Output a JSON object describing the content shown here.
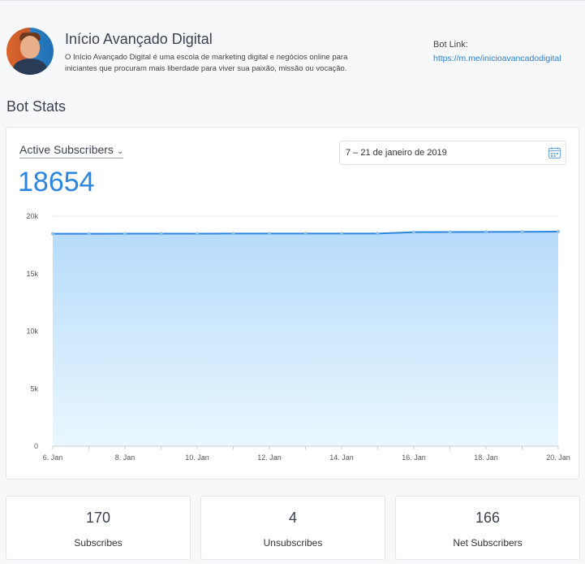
{
  "profile": {
    "name": "Início Avançado Digital",
    "description": "O Início Avançado Digital é uma escola de marketing digital e negócios online para iniciantes que procuram mais liberdade para viver sua paixão, missão ou vocação.",
    "bot_link_label": "Bot Link:",
    "bot_link_url": "https://m.me/inicioavancadodigital"
  },
  "section_title": "Bot Stats",
  "stats_card": {
    "metric_label": "Active Subscribers",
    "date_range": "7 – 21 de janeiro de 2019",
    "current_value": "18654"
  },
  "colors": {
    "accent": "#2a86e0",
    "line": "#2a86e0",
    "fill_top": "#b7dbfb",
    "fill_bottom": "#e9f7fe"
  },
  "chart_data": {
    "type": "area",
    "x": [
      "6. Jan",
      "7. Jan",
      "8. Jan",
      "9. Jan",
      "10. Jan",
      "11. Jan",
      "12. Jan",
      "13. Jan",
      "14. Jan",
      "15. Jan",
      "16. Jan",
      "17. Jan",
      "18. Jan",
      "19. Jan",
      "20. Jan"
    ],
    "xtick_labels": [
      "6. Jan",
      "8. Jan",
      "10. Jan",
      "12. Jan",
      "14. Jan",
      "16. Jan",
      "18. Jan",
      "20. Jan"
    ],
    "values": [
      18470,
      18470,
      18480,
      18480,
      18480,
      18490,
      18490,
      18490,
      18490,
      18490,
      18610,
      18620,
      18630,
      18640,
      18654
    ],
    "yticks": [
      "0",
      "5k",
      "10k",
      "15k",
      "20k"
    ],
    "ylim": [
      0,
      20000
    ],
    "grid": true,
    "title": "",
    "xlabel": "",
    "ylabel": ""
  },
  "summary": [
    {
      "value": "170",
      "label": "Subscribes"
    },
    {
      "value": "4",
      "label": "Unsubscribes"
    },
    {
      "value": "166",
      "label": "Net Subscribers"
    }
  ]
}
